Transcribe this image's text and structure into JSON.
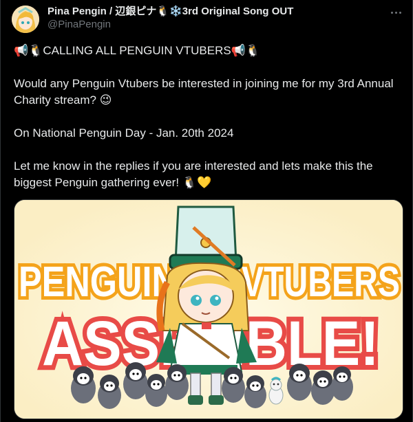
{
  "author": {
    "display_name": "Pina Pengin / 辺銀ピナ🐧❄️3rd Original Song OUT",
    "handle": "@PinaPengin"
  },
  "tweet": {
    "line1": "📢🐧CALLING ALL PENGUIN VTUBERS📢🐧",
    "line2": "Would any Penguin Vtubers be interested in joining me for my 3rd Annual Charity stream? 😉",
    "line3": "On National Penguin Day - Jan. 20th 2024",
    "line4": "Let me know in the replies if you are interested and lets make this the biggest Penguin gathering ever! 🐧💛"
  },
  "media": {
    "title_top_left": "PENGUIN",
    "title_top_right": "VTUBERS",
    "title_bottom": "ASSEMBLE!"
  },
  "icons": {
    "more": "more-icon",
    "megaphone": "megaphone-icon",
    "penguin": "penguin-icon"
  },
  "colors": {
    "background": "#000000",
    "text": "#e7e9ea",
    "muted": "#71767b",
    "banner_orange": "#f4a31b",
    "banner_red": "#e84b47",
    "banner_bg": "#fdf3d2"
  }
}
